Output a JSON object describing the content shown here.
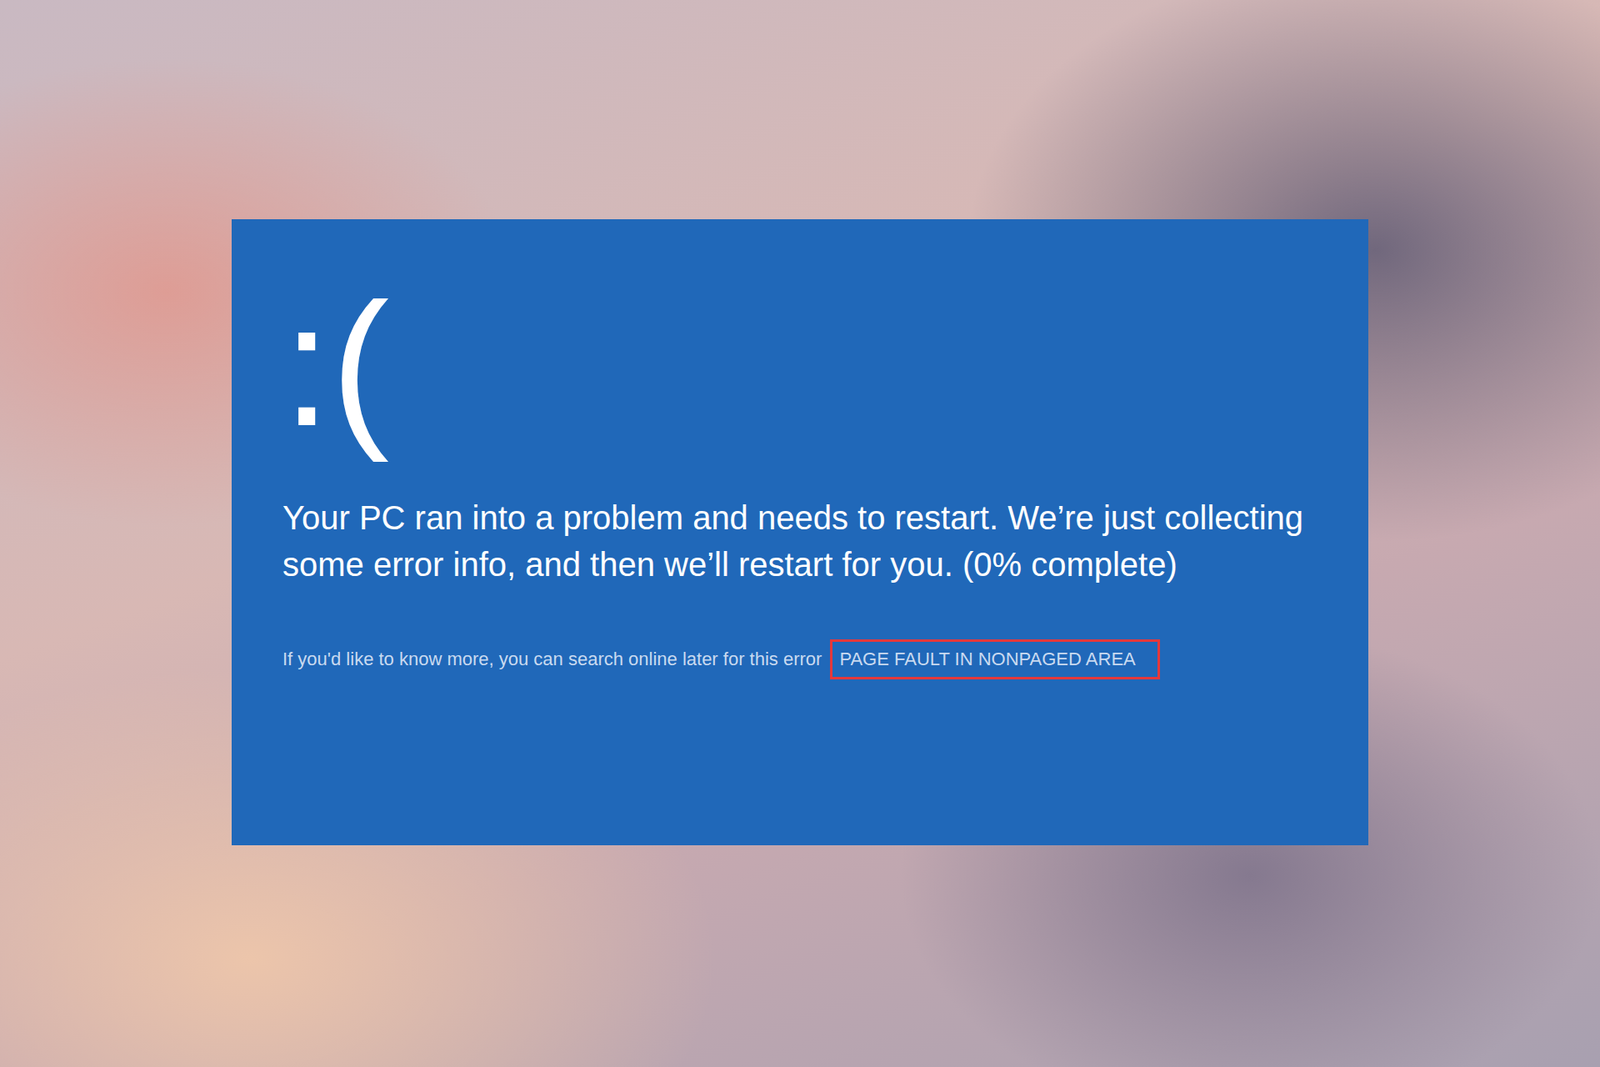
{
  "screen": {
    "face": ":(",
    "message": "Your PC ran into a problem and needs to restart. We’re just collecting some error info, and then we’ll restart for you. (0% complete)",
    "hint": "If you'd like to know more, you can search online later for this error",
    "stop_code": "PAGE FAULT IN NONPAGED AREA",
    "highlighted": true
  }
}
